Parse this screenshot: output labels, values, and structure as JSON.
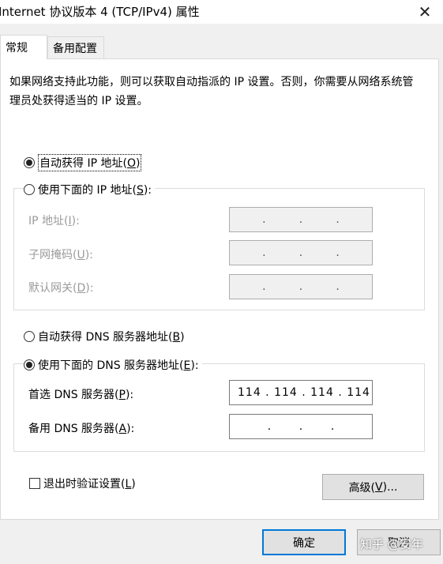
{
  "window": {
    "title": "Internet 协议版本 4 (TCP/IPv4) 属性",
    "close_glyph": "✕"
  },
  "tabs": [
    {
      "label": "常规",
      "selected": true
    },
    {
      "label": "备用配置",
      "selected": false
    }
  ],
  "description": "如果网络支持此功能，则可以获取自动指派的 IP 设置。否则，你需要从网络系统管理员处获得适当的 IP 设置。",
  "ip": {
    "auto_label": "自动获得 IP 地址(",
    "auto_key": "O",
    "auto_suffix": ")",
    "manual_label": "使用下面的 IP 地址(",
    "manual_key": "S",
    "manual_suffix": "):",
    "selected": "auto",
    "fields": [
      {
        "label": "IP 地址(",
        "key": "I",
        "suffix": "):",
        "value": [
          ".",
          ".",
          "."
        ]
      },
      {
        "label": "子网掩码(",
        "key": "U",
        "suffix": "):",
        "value": [
          ".",
          ".",
          "."
        ]
      },
      {
        "label": "默认网关(",
        "key": "D",
        "suffix": "):",
        "value": [
          ".",
          ".",
          "."
        ]
      }
    ]
  },
  "dns": {
    "auto_label": "自动获得 DNS 服务器地址(",
    "auto_key": "B",
    "auto_suffix": ")",
    "manual_label": "使用下面的 DNS 服务器地址(",
    "manual_key": "E",
    "manual_suffix": "):",
    "selected": "manual",
    "preferred": {
      "label": "首选 DNS 服务器(",
      "key": "P",
      "suffix": "):",
      "value": "114 . 114 . 114 . 114"
    },
    "alternate": {
      "label": "备用 DNS 服务器(",
      "key": "A",
      "suffix": "):",
      "value": ".        .        ."
    }
  },
  "validate": {
    "label": "退出时验证设置(",
    "key": "L",
    "suffix": ")",
    "checked": false
  },
  "buttons": {
    "advanced": "高级(",
    "advanced_key": "V",
    "advanced_suffix": ")...",
    "ok": "确定",
    "cancel": "取消"
  },
  "watermark": "知乎 @安年",
  "colors": {
    "accent": "#0078d7",
    "panel": "#ffffff",
    "background": "#f0f0f0"
  }
}
